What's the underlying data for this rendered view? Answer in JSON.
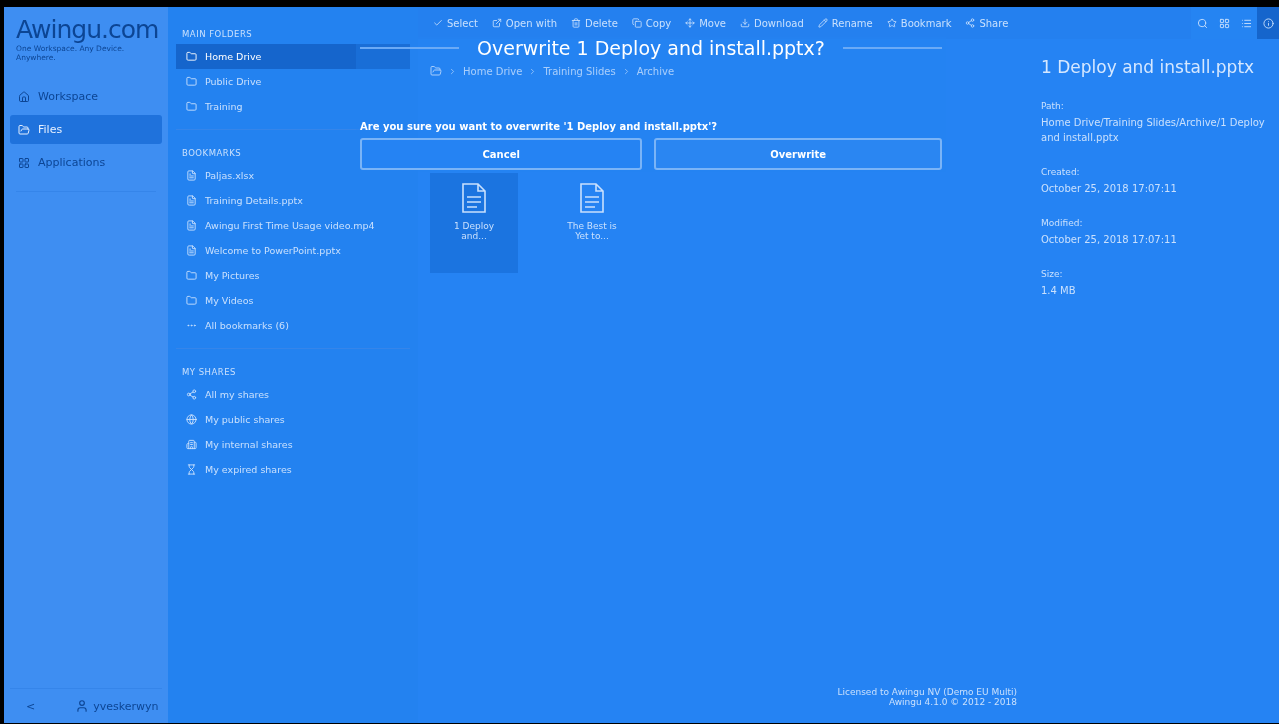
{
  "nav": {
    "logo": "Awingu.com",
    "tagline": "One Workspace. Any Device. Anywhere.",
    "items": [
      {
        "label": "Workspace",
        "selected": false
      },
      {
        "label": "Files",
        "selected": true
      },
      {
        "label": "Applications",
        "selected": false
      }
    ],
    "collapse": "<",
    "user": "yveskerwyn"
  },
  "folders": {
    "sections": [
      {
        "title": "MAIN FOLDERS",
        "items": [
          {
            "label": "Home Drive",
            "selected": true
          },
          {
            "label": "Public Drive",
            "selected": false
          },
          {
            "label": "Training",
            "selected": false
          }
        ]
      },
      {
        "title": "BOOKMARKS",
        "items": [
          {
            "label": "Paljas.xlsx",
            "selected": false
          },
          {
            "label": "Training Details.pptx",
            "selected": false
          },
          {
            "label": "Awingu First Time Usage video.mp4",
            "selected": false
          },
          {
            "label": "Welcome to PowerPoint.pptx",
            "selected": false
          },
          {
            "label": "My Pictures",
            "selected": false
          },
          {
            "label": "My Videos",
            "selected": false
          },
          {
            "label": "All bookmarks (6)",
            "selected": false
          }
        ]
      },
      {
        "title": "MY SHARES",
        "items": [
          {
            "label": "All my shares",
            "selected": false
          },
          {
            "label": "My public shares",
            "selected": false
          },
          {
            "label": "My internal shares",
            "selected": false
          },
          {
            "label": "My expired shares",
            "selected": false
          }
        ]
      }
    ]
  },
  "toolbar": {
    "actions": [
      "Select",
      "Open with",
      "Delete",
      "Copy",
      "Move",
      "Download",
      "Rename",
      "Bookmark",
      "Share"
    ],
    "views": [
      {
        "selected": false
      },
      {
        "selected": false
      },
      {
        "selected": false
      },
      {
        "selected": true
      }
    ]
  },
  "breadcrumb": [
    "Home Drive",
    "Training Slides",
    "Archive"
  ],
  "files": [
    {
      "name": "1 Deploy and...",
      "selected": true
    },
    {
      "name": "The Best is Yet to...",
      "selected": false
    }
  ],
  "details": {
    "title": "1 Deploy and install.pptx",
    "fields": [
      {
        "label": "Path:",
        "value": "Home Drive/Training Slides/Archive/1 Deploy and install.pptx"
      },
      {
        "label": "Created:",
        "value": "October 25, 2018 17:07:11"
      },
      {
        "label": "Modified:",
        "value": "October 25, 2018 17:07:11"
      },
      {
        "label": "Size:",
        "value": "1.4 MB"
      }
    ]
  },
  "footer": [
    "Licensed to Awingu NV (Demo EU Multi)",
    "Awingu 4.1.0 © 2012 - 2018"
  ],
  "dialog": {
    "title": "Overwrite 1 Deploy and install.pptx?",
    "message": "Are you sure you want to overwrite '1 Deploy and install.pptx'?",
    "buttons": [
      {
        "label": "Cancel",
        "kind": "secondary"
      },
      {
        "label": "Overwrite",
        "kind": "primary"
      }
    ]
  }
}
